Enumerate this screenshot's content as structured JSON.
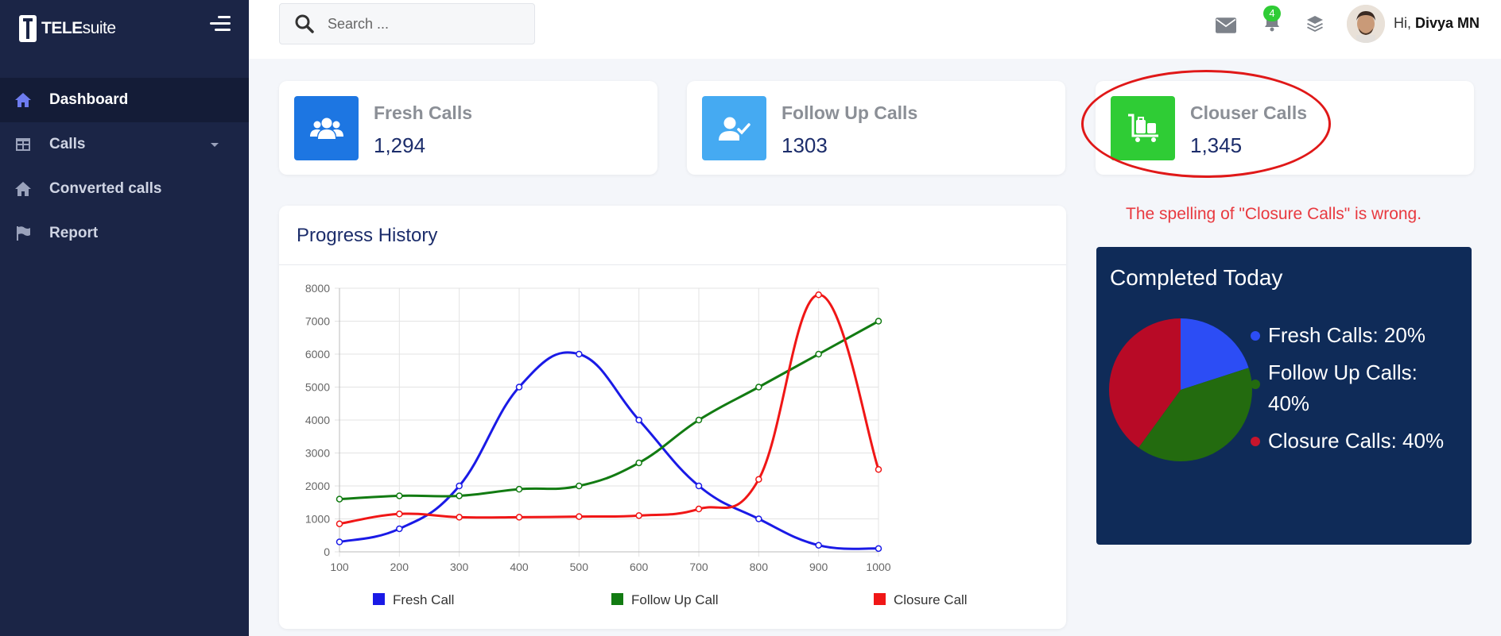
{
  "brand": {
    "name_bold": "TELE",
    "name_rest": "suite"
  },
  "sidebar": {
    "items": [
      {
        "label": "Dashboard",
        "icon": "home-icon",
        "active": true
      },
      {
        "label": "Calls",
        "icon": "table-icon",
        "has_submenu": true
      },
      {
        "label": "Converted calls",
        "icon": "home-icon"
      },
      {
        "label": "Report",
        "icon": "flag-icon"
      }
    ]
  },
  "topbar": {
    "search_placeholder": "Search ...",
    "notification_count": "4",
    "greeting_prefix": "Hi,",
    "user_name": "Divya MN"
  },
  "stats": [
    {
      "title": "Fresh Calls",
      "value": "1,294",
      "color": "#1d76e2",
      "icon": "users-icon"
    },
    {
      "title": "Follow Up Calls",
      "value": "1303",
      "color": "#45aaf2",
      "icon": "user-check-icon"
    },
    {
      "title": "Clouser Calls",
      "value": "1,345",
      "color": "#2fcc35",
      "icon": "luggage-cart-icon"
    }
  ],
  "annotation": {
    "text": "The spelling of \"Closure Calls\" is wrong."
  },
  "progress": {
    "title": "Progress History"
  },
  "chart_data": {
    "type": "line",
    "x": [
      100,
      200,
      300,
      400,
      500,
      600,
      700,
      800,
      900,
      1000
    ],
    "ylim": [
      0,
      8000
    ],
    "yticks": [
      0,
      1000,
      2000,
      3000,
      4000,
      5000,
      6000,
      7000,
      8000
    ],
    "grid": true,
    "legend_position": "bottom",
    "series": [
      {
        "name": "Fresh Call",
        "color": "#1a1ae6",
        "values": [
          300,
          700,
          2000,
          5000,
          6000,
          4000,
          2000,
          1000,
          200,
          100
        ]
      },
      {
        "name": "Follow Up Call",
        "color": "#127b12",
        "values": [
          1600,
          1700,
          1700,
          1900,
          2000,
          2700,
          4000,
          5000,
          6000,
          7000
        ]
      },
      {
        "name": "Closure Call",
        "color": "#f01616",
        "values": [
          850,
          1150,
          1050,
          1050,
          1070,
          1100,
          1300,
          2200,
          7800,
          2500
        ]
      }
    ]
  },
  "completed_today": {
    "title": "Completed Today",
    "chart_data": {
      "type": "pie",
      "slices": [
        {
          "label": "Fresh Calls: 20%",
          "value": 20,
          "color": "#2c4df5",
          "dot_color": "#2c4df5"
        },
        {
          "label": "Follow Up Calls: 40%",
          "value": 40,
          "color": "#236b0f",
          "dot_color": "#236b0f"
        },
        {
          "label": "Closure Calls: 40%",
          "value": 40,
          "color": "#b80a26",
          "dot_color": "#c7152c"
        }
      ]
    }
  }
}
